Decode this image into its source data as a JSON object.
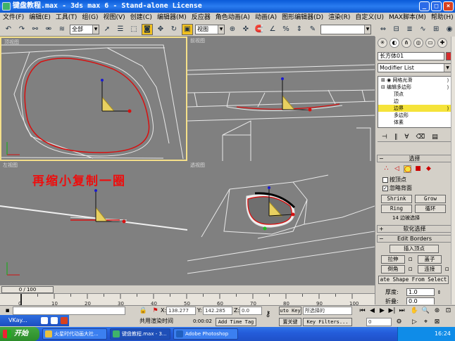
{
  "window": {
    "title": "键盘教程.max - 3ds max 6 - Stand-alone License"
  },
  "menu": [
    "文件(F)",
    "编辑(E)",
    "工具(T)",
    "组(G)",
    "视图(V)",
    "创建(C)",
    "编辑器(M)",
    "反应器",
    "角色动画(A)",
    "动画(A)",
    "图形编辑器(D)",
    "渲染(R)",
    "自定义(U)",
    "MAX脚本(M)",
    "帮助(H)"
  ],
  "toolbar": {
    "selection_filter": "全部",
    "reference_coord": "视图"
  },
  "viewports": {
    "top": {
      "label": "顶视图"
    },
    "front": {
      "label": "前视图"
    },
    "left": {
      "label": "左视图"
    },
    "perspective": {
      "label": "透视图"
    }
  },
  "annotation": "再缩小复制一圈",
  "command_panel": {
    "object_name": "长方体01",
    "modifier_list": "Modifier List",
    "stack": [
      {
        "label": "网格光滑",
        "level": 0
      },
      {
        "label": "编辑多边形",
        "level": 0
      },
      {
        "label": "顶点",
        "level": 1
      },
      {
        "label": "边",
        "level": 1
      },
      {
        "label": "边界",
        "level": 1
      },
      {
        "label": "多边形",
        "level": 1
      },
      {
        "label": "体素",
        "level": 1
      }
    ],
    "selected_stack_item": "边界",
    "selection": {
      "title": "选择",
      "by_vertex": "按顶点",
      "ignore_backfacing": "忽略背面",
      "ignore_backfacing_checked": true,
      "shrink": "Shrink",
      "grow": "Grow",
      "ring": "Ring",
      "loop": "循环",
      "status": "14 边被选择"
    },
    "soft_selection": {
      "title": "软化选择"
    },
    "edit_borders": {
      "title": "Edit Borders",
      "insert_vertex": "插入顶点",
      "extrude": "拉伸",
      "cap": "盖子",
      "chamfer": "倒角",
      "connect": "连接",
      "create_shape": "ate Shape From Select",
      "thickness_label": "厚度:",
      "thickness_value": "1.0",
      "fold_label": "折叠:",
      "fold_value": "0.0"
    }
  },
  "timeline": {
    "frame_display": "0 / 100",
    "ticks": [
      "0",
      "10",
      "20",
      "30",
      "40",
      "50",
      "60",
      "70",
      "80",
      "90",
      "100"
    ],
    "current_frame": 0,
    "total_frames": 100
  },
  "status": {
    "x_label": "X:",
    "x_value": "138.277",
    "y_label": "Y:",
    "y_value": "142.285",
    "z_label": "Z:",
    "z_value": "0.0",
    "shared_render": "共用渲染时间",
    "time": "0:00:02",
    "add_time_tag": "Add Time Tag",
    "auto_key": "uto Key",
    "selected_set": "所选择的",
    "set_key": "置关键",
    "key_filters": "Key Filters...",
    "frame_field": "0"
  },
  "vkay_bar": "VKay...",
  "taskbar": {
    "start": "开始",
    "tasks": [
      "火星时代动画大社...",
      "键盘教程.max - 3...",
      "Adobe Photoshop"
    ],
    "clock": "16:24"
  }
}
